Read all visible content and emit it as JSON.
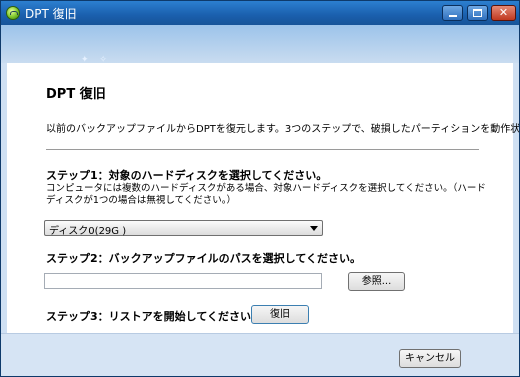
{
  "window": {
    "title": "DPT 復旧",
    "controls": [
      "minimize",
      "maximize",
      "close"
    ]
  },
  "main": {
    "heading": "DPT 復旧",
    "intro": "以前のバックアップファイルからDPTを復元します。3つのステップで、破損したパーティションを動作状態に復元します。",
    "step1": {
      "title": "ステップ1：対象のハードディスクを選択してください。",
      "description": "コンピュータには複数のハードディスクがある場合、対象ハードディスクを選択してください。（ハードディスクが1つの場合は無視してください。）",
      "disk_selected": "ディスク0(29G )"
    },
    "step2": {
      "title": "ステップ2：バックアップファイルのパスを選択してください。",
      "path_value": "",
      "browse_label": "参照..."
    },
    "step3": {
      "title": "ステップ3：リストアを開始してください。",
      "restore_label": "復旧"
    }
  },
  "footer": {
    "cancel_label": "キャンセル"
  },
  "colors": {
    "titlebar": "#1a5fad",
    "banner": "#9cc3ea",
    "footer": "#d6e4f4"
  }
}
